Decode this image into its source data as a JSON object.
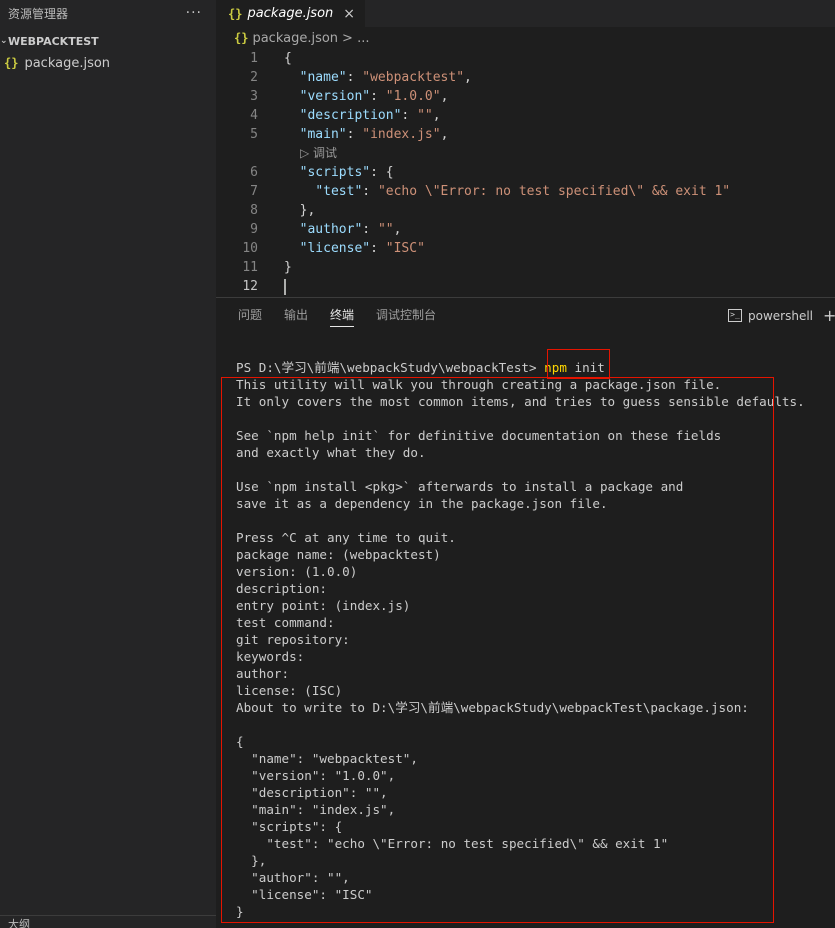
{
  "explorer": {
    "title": "资源管理器",
    "more": "···",
    "folder": "WEBPACKTEST",
    "file": "package.json",
    "bottom_section": "大纲"
  },
  "editor": {
    "tab_label": "package.json",
    "tab_close": "×",
    "breadcrumb_file": "package.json",
    "breadcrumb_more": "> ...",
    "json_icon": "{}",
    "codelens": "▷ 调试",
    "lines": [
      {
        "num": "1",
        "parts": [
          [
            "p",
            "{"
          ]
        ]
      },
      {
        "num": "2",
        "parts": [
          [
            "p",
            "  "
          ],
          [
            "k",
            "\"name\""
          ],
          [
            "p",
            ": "
          ],
          [
            "s",
            "\"webpacktest\""
          ],
          [
            "p",
            ","
          ]
        ]
      },
      {
        "num": "3",
        "parts": [
          [
            "p",
            "  "
          ],
          [
            "k",
            "\"version\""
          ],
          [
            "p",
            ": "
          ],
          [
            "s",
            "\"1.0.0\""
          ],
          [
            "p",
            ","
          ]
        ]
      },
      {
        "num": "4",
        "parts": [
          [
            "p",
            "  "
          ],
          [
            "k",
            "\"description\""
          ],
          [
            "p",
            ": "
          ],
          [
            "s",
            "\"\""
          ],
          [
            "p",
            ","
          ]
        ]
      },
      {
        "num": "5",
        "parts": [
          [
            "p",
            "  "
          ],
          [
            "k",
            "\"main\""
          ],
          [
            "p",
            ": "
          ],
          [
            "s",
            "\"index.js\""
          ],
          [
            "p",
            ","
          ]
        ]
      },
      {
        "num": "6",
        "parts": [
          [
            "p",
            "  "
          ],
          [
            "k",
            "\"scripts\""
          ],
          [
            "p",
            ": {"
          ]
        ]
      },
      {
        "num": "7",
        "parts": [
          [
            "p",
            "    "
          ],
          [
            "k",
            "\"test\""
          ],
          [
            "p",
            ": "
          ],
          [
            "s",
            "\"echo \\\"Error: no test specified\\\" && exit 1\""
          ]
        ]
      },
      {
        "num": "8",
        "parts": [
          [
            "p",
            "  },"
          ]
        ]
      },
      {
        "num": "9",
        "parts": [
          [
            "p",
            "  "
          ],
          [
            "k",
            "\"author\""
          ],
          [
            "p",
            ": "
          ],
          [
            "s",
            "\"\""
          ],
          [
            "p",
            ","
          ]
        ]
      },
      {
        "num": "10",
        "parts": [
          [
            "p",
            "  "
          ],
          [
            "k",
            "\"license\""
          ],
          [
            "p",
            ": "
          ],
          [
            "s",
            "\"ISC\""
          ]
        ]
      },
      {
        "num": "11",
        "parts": [
          [
            "p",
            "}"
          ]
        ]
      },
      {
        "num": "12",
        "parts": []
      }
    ]
  },
  "panel": {
    "tabs": [
      "问题",
      "输出",
      "终端",
      "调试控制台"
    ],
    "active_tab": "终端",
    "shell": "powershell",
    "add": "+"
  },
  "terminal": {
    "prompt": "PS D:\\学习\\前端\\webpackStudy\\webpackTest> ",
    "cmd_name": "npm",
    "cmd_args": " init",
    "lines": [
      "This utility will walk you through creating a package.json file.",
      "It only covers the most common items, and tries to guess sensible defaults.",
      "",
      "See `npm help init` for definitive documentation on these fields",
      "and exactly what they do.",
      "",
      "Use `npm install <pkg>` afterwards to install a package and",
      "save it as a dependency in the package.json file.",
      "",
      "Press ^C at any time to quit.",
      "package name: (webpacktest)",
      "version: (1.0.0)",
      "description:",
      "entry point: (index.js)",
      "test command:",
      "git repository:",
      "keywords:",
      "author:",
      "license: (ISC)",
      "About to write to D:\\学习\\前端\\webpackStudy\\webpackTest\\package.json:",
      "",
      "{",
      "  \"name\": \"webpacktest\",",
      "  \"version\": \"1.0.0\",",
      "  \"description\": \"\",",
      "  \"main\": \"index.js\",",
      "  \"scripts\": {",
      "    \"test\": \"echo \\\"Error: no test specified\\\" && exit 1\"",
      "  },",
      "  \"author\": \"\",",
      "  \"license\": \"ISC\"",
      "}"
    ]
  },
  "colors": {
    "highlight_box": "#e51400",
    "json_key": "#9cdcfe",
    "json_string": "#ce9178",
    "npm_command": "#ffd700"
  }
}
